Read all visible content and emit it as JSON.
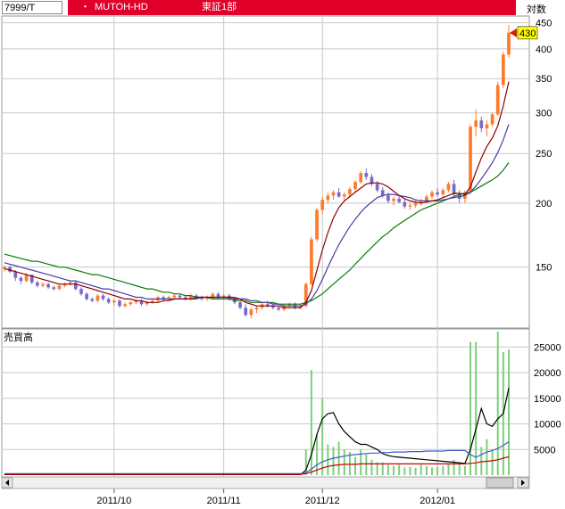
{
  "header": {
    "code": "7999/T",
    "bullet": "・",
    "name": "MUTOH-HD",
    "market": "東証1部",
    "scale": "対数"
  },
  "colors": {
    "up": "#ff7a2a",
    "down": "#7b68c8",
    "ma_short": "#8b0000",
    "ma_mid": "#4b3aa8",
    "ma_long": "#0a7a0a",
    "volume": "#7ccf7c",
    "price_tag": "#ffff00",
    "title_bg": "#e0002a"
  },
  "chart_data": [
    {
      "type": "candlestick",
      "scale": "log",
      "y_ticks": [
        "150",
        "200",
        "250",
        "300",
        "350",
        "400",
        "450"
      ],
      "ylim": [
        115,
        460
      ],
      "x_ticks": [
        "2011/10",
        "2011/11",
        "2011/12",
        "2012/01"
      ],
      "last_price": "430",
      "candles": [
        [
          149,
          151,
          147,
          150
        ],
        [
          150,
          151,
          146,
          147
        ],
        [
          147,
          148,
          141,
          143
        ],
        [
          143,
          144,
          139,
          141
        ],
        [
          141,
          146,
          140,
          145
        ],
        [
          145,
          145,
          139,
          140
        ],
        [
          140,
          141,
          137,
          138
        ],
        [
          138,
          140,
          137,
          139
        ],
        [
          139,
          140,
          136,
          137
        ],
        [
          137,
          138,
          135,
          136
        ],
        [
          136,
          139,
          135,
          138
        ],
        [
          138,
          140,
          137,
          139
        ],
        [
          139,
          141,
          138,
          140
        ],
        [
          140,
          141,
          135,
          136
        ],
        [
          136,
          137,
          132,
          133
        ],
        [
          133,
          134,
          129,
          130
        ],
        [
          130,
          131,
          128,
          129
        ],
        [
          129,
          133,
          128,
          132
        ],
        [
          132,
          133,
          129,
          130
        ],
        [
          130,
          131,
          127,
          128
        ],
        [
          128,
          130,
          126,
          129
        ],
        [
          129,
          130,
          125,
          126
        ],
        [
          126,
          128,
          125,
          127
        ],
        [
          127,
          129,
          126,
          128
        ],
        [
          128,
          130,
          127,
          129
        ],
        [
          129,
          130,
          126,
          127
        ],
        [
          127,
          129,
          126,
          128
        ],
        [
          128,
          130,
          127,
          129
        ],
        [
          129,
          132,
          128,
          131
        ],
        [
          131,
          132,
          129,
          130
        ],
        [
          130,
          132,
          129,
          131
        ],
        [
          131,
          133,
          130,
          132
        ],
        [
          132,
          133,
          130,
          131
        ],
        [
          131,
          132,
          129,
          130
        ],
        [
          130,
          133,
          129,
          132
        ],
        [
          132,
          133,
          130,
          131
        ],
        [
          131,
          132,
          129,
          130
        ],
        [
          130,
          132,
          129,
          131
        ],
        [
          131,
          134,
          130,
          133
        ],
        [
          133,
          134,
          130,
          131
        ],
        [
          131,
          133,
          130,
          132
        ],
        [
          132,
          133,
          129,
          130
        ],
        [
          130,
          131,
          127,
          128
        ],
        [
          128,
          129,
          124,
          125
        ],
        [
          125,
          127,
          120,
          121
        ],
        [
          121,
          125,
          119,
          124
        ],
        [
          124,
          126,
          122,
          125
        ],
        [
          125,
          128,
          124,
          127
        ],
        [
          127,
          129,
          125,
          126
        ],
        [
          126,
          128,
          124,
          125
        ],
        [
          125,
          126,
          123,
          124
        ],
        [
          124,
          127,
          123,
          126
        ],
        [
          126,
          128,
          125,
          127
        ],
        [
          127,
          128,
          124,
          125
        ],
        [
          125,
          127,
          124,
          126
        ],
        [
          126,
          140,
          125,
          139
        ],
        [
          139,
          172,
          138,
          170
        ],
        [
          170,
          196,
          168,
          194
        ],
        [
          194,
          206,
          190,
          203
        ],
        [
          203,
          210,
          200,
          207
        ],
        [
          207,
          212,
          203,
          210
        ],
        [
          210,
          214,
          205,
          206
        ],
        [
          206,
          210,
          202,
          208
        ],
        [
          208,
          215,
          205,
          213
        ],
        [
          213,
          222,
          210,
          220
        ],
        [
          220,
          231,
          218,
          229
        ],
        [
          229,
          234,
          222,
          225
        ],
        [
          225,
          228,
          216,
          218
        ],
        [
          218,
          221,
          210,
          212
        ],
        [
          212,
          215,
          205,
          207
        ],
        [
          207,
          210,
          200,
          202
        ],
        [
          202,
          206,
          198,
          204
        ],
        [
          204,
          207,
          200,
          201
        ],
        [
          201,
          203,
          195,
          197
        ],
        [
          197,
          200,
          194,
          198
        ],
        [
          198,
          202,
          196,
          200
        ],
        [
          200,
          204,
          198,
          202
        ],
        [
          202,
          208,
          200,
          206
        ],
        [
          206,
          212,
          204,
          210
        ],
        [
          210,
          214,
          206,
          208
        ],
        [
          208,
          214,
          205,
          212
        ],
        [
          212,
          220,
          210,
          218
        ],
        [
          218,
          222,
          205,
          208
        ],
        [
          208,
          212,
          200,
          204
        ],
        [
          204,
          212,
          200,
          210
        ],
        [
          210,
          285,
          208,
          282
        ],
        [
          282,
          305,
          270,
          290
        ],
        [
          290,
          295,
          275,
          280
        ],
        [
          280,
          290,
          270,
          285
        ],
        [
          285,
          300,
          282,
          298
        ],
        [
          298,
          345,
          296,
          340
        ],
        [
          340,
          395,
          335,
          390
        ],
        [
          390,
          445,
          385,
          430
        ]
      ],
      "ma_short": [
        149,
        148,
        147,
        146,
        145,
        144,
        143,
        142,
        141,
        140,
        139,
        139,
        139,
        139,
        138,
        137,
        136,
        135,
        134,
        133,
        132,
        131,
        130,
        130,
        129,
        129,
        128,
        128,
        128,
        129,
        129,
        130,
        130,
        130,
        130,
        131,
        131,
        131,
        131,
        131,
        131,
        131,
        130,
        130,
        128,
        127,
        126,
        126,
        126,
        126,
        126,
        125,
        125,
        125,
        125,
        128,
        135,
        148,
        162,
        175,
        187,
        196,
        202,
        206,
        210,
        214,
        218,
        219,
        219,
        218,
        215,
        211,
        207,
        204,
        202,
        201,
        200,
        201,
        202,
        203,
        205,
        207,
        209,
        209,
        208,
        215,
        230,
        245,
        258,
        268,
        283,
        310,
        345
      ],
      "ma_mid": [
        153,
        152,
        151,
        150,
        149,
        148,
        147,
        146,
        145,
        144,
        143,
        142,
        141,
        141,
        140,
        139,
        138,
        137,
        136,
        136,
        135,
        134,
        133,
        132,
        131,
        131,
        130,
        130,
        130,
        130,
        130,
        130,
        130,
        130,
        130,
        130,
        131,
        131,
        131,
        131,
        131,
        131,
        131,
        130,
        130,
        129,
        129,
        128,
        128,
        127,
        127,
        126,
        126,
        126,
        126,
        127,
        130,
        135,
        142,
        150,
        158,
        166,
        173,
        180,
        186,
        192,
        197,
        201,
        205,
        207,
        208,
        208,
        207,
        206,
        205,
        203,
        202,
        202,
        202,
        202,
        203,
        204,
        205,
        206,
        207,
        210,
        216,
        223,
        231,
        240,
        251,
        266,
        285
      ],
      "ma_long": [
        159,
        158,
        157,
        156,
        155,
        154,
        154,
        153,
        152,
        151,
        150,
        150,
        149,
        148,
        147,
        146,
        145,
        145,
        144,
        143,
        142,
        141,
        140,
        139,
        138,
        137,
        136,
        136,
        135,
        134,
        134,
        133,
        133,
        132,
        132,
        131,
        131,
        131,
        130,
        130,
        130,
        130,
        129,
        129,
        129,
        128,
        128,
        128,
        128,
        128,
        127,
        127,
        127,
        127,
        127,
        128,
        129,
        131,
        133,
        136,
        139,
        142,
        145,
        148,
        152,
        156,
        160,
        164,
        168,
        172,
        175,
        179,
        182,
        185,
        188,
        191,
        194,
        196,
        198,
        200,
        202,
        204,
        206,
        208,
        209,
        210,
        213,
        216,
        219,
        222,
        226,
        232,
        240
      ]
    },
    {
      "type": "bar",
      "title": "売買高",
      "y_ticks": [
        "5000",
        "10000",
        "15000",
        "20000",
        "25000"
      ],
      "ylim": [
        0,
        28000
      ],
      "volumes": [
        200,
        200,
        180,
        150,
        200,
        220,
        180,
        150,
        160,
        150,
        180,
        200,
        150,
        160,
        180,
        150,
        140,
        160,
        150,
        150,
        170,
        150,
        140,
        160,
        150,
        150,
        160,
        170,
        150,
        150,
        140,
        160,
        150,
        150,
        170,
        150,
        150,
        160,
        140,
        160,
        150,
        150,
        170,
        150,
        180,
        160,
        150,
        140,
        150,
        160,
        150,
        150,
        160,
        150,
        150,
        5000,
        20500,
        8000,
        15000,
        6000,
        5500,
        6500,
        5000,
        4500,
        3500,
        5000,
        4000,
        3000,
        2500,
        2500,
        2000,
        1800,
        2000,
        1500,
        1600,
        1400,
        2000,
        1800,
        1500,
        1600,
        1800,
        2200,
        3000,
        2500,
        1800,
        26000,
        26000,
        5500,
        7000,
        5000,
        28000,
        24000,
        24500
      ],
      "line_a": [
        100,
        100,
        100,
        100,
        100,
        100,
        100,
        100,
        100,
        100,
        100,
        100,
        100,
        100,
        100,
        100,
        100,
        100,
        100,
        100,
        100,
        100,
        100,
        100,
        100,
        100,
        100,
        100,
        100,
        100,
        100,
        100,
        100,
        100,
        100,
        100,
        100,
        100,
        100,
        100,
        100,
        100,
        100,
        100,
        100,
        100,
        100,
        100,
        100,
        100,
        100,
        100,
        100,
        100,
        100,
        1000,
        4000,
        8000,
        11000,
        12000,
        12200,
        10000,
        8500,
        7500,
        6500,
        6000,
        6000,
        5500,
        5000,
        4200,
        3800,
        3600,
        3500,
        3400,
        3300,
        3200,
        3100,
        3000,
        2900,
        2800,
        2700,
        2600,
        2500,
        2400,
        2300,
        5000,
        9000,
        13000,
        10000,
        9500,
        11000,
        12000,
        17000
      ],
      "line_b": [
        300,
        300,
        300,
        300,
        300,
        300,
        300,
        300,
        300,
        300,
        300,
        300,
        300,
        300,
        300,
        300,
        300,
        300,
        300,
        300,
        300,
        300,
        300,
        300,
        300,
        300,
        300,
        300,
        300,
        300,
        300,
        300,
        300,
        300,
        300,
        300,
        300,
        300,
        300,
        300,
        300,
        300,
        300,
        300,
        300,
        300,
        300,
        300,
        300,
        300,
        300,
        300,
        300,
        300,
        300,
        500,
        1200,
        2000,
        2600,
        3000,
        3300,
        3500,
        3700,
        3900,
        4000,
        4100,
        4200,
        4300,
        4300,
        4400,
        4400,
        4500,
        4500,
        4500,
        4600,
        4600,
        4600,
        4700,
        4700,
        4700,
        4700,
        4800,
        4800,
        4800,
        4800,
        4000,
        3500,
        4000,
        4500,
        4800,
        5200,
        5800,
        6500
      ],
      "line_c": [
        150,
        150,
        150,
        150,
        150,
        150,
        150,
        150,
        150,
        150,
        150,
        150,
        150,
        150,
        150,
        150,
        150,
        150,
        150,
        150,
        150,
        150,
        150,
        150,
        150,
        150,
        150,
        150,
        150,
        150,
        150,
        150,
        150,
        150,
        150,
        150,
        150,
        150,
        150,
        150,
        150,
        150,
        150,
        150,
        150,
        150,
        150,
        150,
        150,
        150,
        150,
        150,
        150,
        150,
        150,
        300,
        600,
        1000,
        1400,
        1700,
        1900,
        2000,
        2100,
        2100,
        2100,
        2200,
        2200,
        2200,
        2200,
        2200,
        2200,
        2200,
        2200,
        2200,
        2200,
        2200,
        2200,
        2200,
        2200,
        2200,
        2200,
        2200,
        2200,
        2200,
        2200,
        2300,
        2400,
        2600,
        2700,
        2800,
        3000,
        3300,
        3600
      ]
    }
  ]
}
